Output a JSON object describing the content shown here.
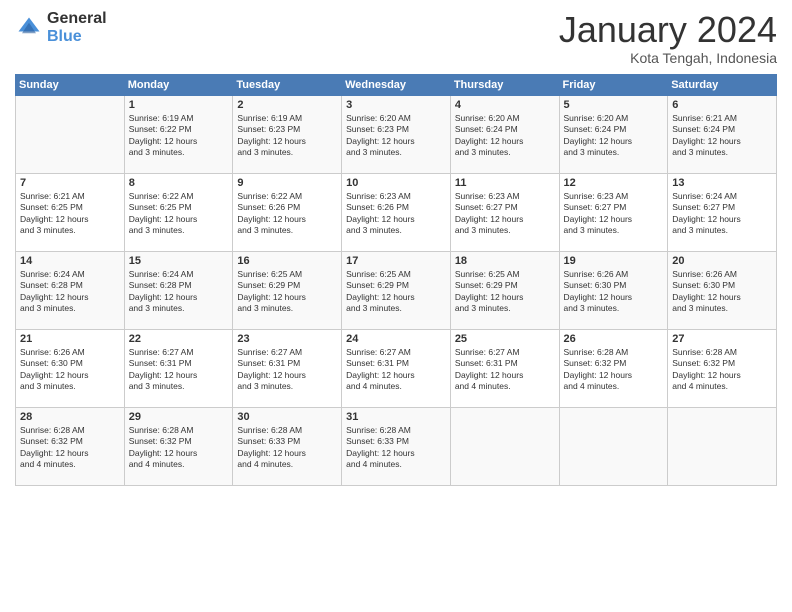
{
  "header": {
    "logo_general": "General",
    "logo_blue": "Blue",
    "month_title": "January 2024",
    "subtitle": "Kota Tengah, Indonesia"
  },
  "days_of_week": [
    "Sunday",
    "Monday",
    "Tuesday",
    "Wednesday",
    "Thursday",
    "Friday",
    "Saturday"
  ],
  "weeks": [
    [
      {
        "day": "",
        "lines": []
      },
      {
        "day": "1",
        "lines": [
          "Sunrise: 6:19 AM",
          "Sunset: 6:22 PM",
          "Daylight: 12 hours",
          "and 3 minutes."
        ]
      },
      {
        "day": "2",
        "lines": [
          "Sunrise: 6:19 AM",
          "Sunset: 6:23 PM",
          "Daylight: 12 hours",
          "and 3 minutes."
        ]
      },
      {
        "day": "3",
        "lines": [
          "Sunrise: 6:20 AM",
          "Sunset: 6:23 PM",
          "Daylight: 12 hours",
          "and 3 minutes."
        ]
      },
      {
        "day": "4",
        "lines": [
          "Sunrise: 6:20 AM",
          "Sunset: 6:24 PM",
          "Daylight: 12 hours",
          "and 3 minutes."
        ]
      },
      {
        "day": "5",
        "lines": [
          "Sunrise: 6:20 AM",
          "Sunset: 6:24 PM",
          "Daylight: 12 hours",
          "and 3 minutes."
        ]
      },
      {
        "day": "6",
        "lines": [
          "Sunrise: 6:21 AM",
          "Sunset: 6:24 PM",
          "Daylight: 12 hours",
          "and 3 minutes."
        ]
      }
    ],
    [
      {
        "day": "7",
        "lines": [
          "Sunrise: 6:21 AM",
          "Sunset: 6:25 PM",
          "Daylight: 12 hours",
          "and 3 minutes."
        ]
      },
      {
        "day": "8",
        "lines": [
          "Sunrise: 6:22 AM",
          "Sunset: 6:25 PM",
          "Daylight: 12 hours",
          "and 3 minutes."
        ]
      },
      {
        "day": "9",
        "lines": [
          "Sunrise: 6:22 AM",
          "Sunset: 6:26 PM",
          "Daylight: 12 hours",
          "and 3 minutes."
        ]
      },
      {
        "day": "10",
        "lines": [
          "Sunrise: 6:23 AM",
          "Sunset: 6:26 PM",
          "Daylight: 12 hours",
          "and 3 minutes."
        ]
      },
      {
        "day": "11",
        "lines": [
          "Sunrise: 6:23 AM",
          "Sunset: 6:27 PM",
          "Daylight: 12 hours",
          "and 3 minutes."
        ]
      },
      {
        "day": "12",
        "lines": [
          "Sunrise: 6:23 AM",
          "Sunset: 6:27 PM",
          "Daylight: 12 hours",
          "and 3 minutes."
        ]
      },
      {
        "day": "13",
        "lines": [
          "Sunrise: 6:24 AM",
          "Sunset: 6:27 PM",
          "Daylight: 12 hours",
          "and 3 minutes."
        ]
      }
    ],
    [
      {
        "day": "14",
        "lines": [
          "Sunrise: 6:24 AM",
          "Sunset: 6:28 PM",
          "Daylight: 12 hours",
          "and 3 minutes."
        ]
      },
      {
        "day": "15",
        "lines": [
          "Sunrise: 6:24 AM",
          "Sunset: 6:28 PM",
          "Daylight: 12 hours",
          "and 3 minutes."
        ]
      },
      {
        "day": "16",
        "lines": [
          "Sunrise: 6:25 AM",
          "Sunset: 6:29 PM",
          "Daylight: 12 hours",
          "and 3 minutes."
        ]
      },
      {
        "day": "17",
        "lines": [
          "Sunrise: 6:25 AM",
          "Sunset: 6:29 PM",
          "Daylight: 12 hours",
          "and 3 minutes."
        ]
      },
      {
        "day": "18",
        "lines": [
          "Sunrise: 6:25 AM",
          "Sunset: 6:29 PM",
          "Daylight: 12 hours",
          "and 3 minutes."
        ]
      },
      {
        "day": "19",
        "lines": [
          "Sunrise: 6:26 AM",
          "Sunset: 6:30 PM",
          "Daylight: 12 hours",
          "and 3 minutes."
        ]
      },
      {
        "day": "20",
        "lines": [
          "Sunrise: 6:26 AM",
          "Sunset: 6:30 PM",
          "Daylight: 12 hours",
          "and 3 minutes."
        ]
      }
    ],
    [
      {
        "day": "21",
        "lines": [
          "Sunrise: 6:26 AM",
          "Sunset: 6:30 PM",
          "Daylight: 12 hours",
          "and 3 minutes."
        ]
      },
      {
        "day": "22",
        "lines": [
          "Sunrise: 6:27 AM",
          "Sunset: 6:31 PM",
          "Daylight: 12 hours",
          "and 3 minutes."
        ]
      },
      {
        "day": "23",
        "lines": [
          "Sunrise: 6:27 AM",
          "Sunset: 6:31 PM",
          "Daylight: 12 hours",
          "and 3 minutes."
        ]
      },
      {
        "day": "24",
        "lines": [
          "Sunrise: 6:27 AM",
          "Sunset: 6:31 PM",
          "Daylight: 12 hours",
          "and 4 minutes."
        ]
      },
      {
        "day": "25",
        "lines": [
          "Sunrise: 6:27 AM",
          "Sunset: 6:31 PM",
          "Daylight: 12 hours",
          "and 4 minutes."
        ]
      },
      {
        "day": "26",
        "lines": [
          "Sunrise: 6:28 AM",
          "Sunset: 6:32 PM",
          "Daylight: 12 hours",
          "and 4 minutes."
        ]
      },
      {
        "day": "27",
        "lines": [
          "Sunrise: 6:28 AM",
          "Sunset: 6:32 PM",
          "Daylight: 12 hours",
          "and 4 minutes."
        ]
      }
    ],
    [
      {
        "day": "28",
        "lines": [
          "Sunrise: 6:28 AM",
          "Sunset: 6:32 PM",
          "Daylight: 12 hours",
          "and 4 minutes."
        ]
      },
      {
        "day": "29",
        "lines": [
          "Sunrise: 6:28 AM",
          "Sunset: 6:32 PM",
          "Daylight: 12 hours",
          "and 4 minutes."
        ]
      },
      {
        "day": "30",
        "lines": [
          "Sunrise: 6:28 AM",
          "Sunset: 6:33 PM",
          "Daylight: 12 hours",
          "and 4 minutes."
        ]
      },
      {
        "day": "31",
        "lines": [
          "Sunrise: 6:28 AM",
          "Sunset: 6:33 PM",
          "Daylight: 12 hours",
          "and 4 minutes."
        ]
      },
      {
        "day": "",
        "lines": []
      },
      {
        "day": "",
        "lines": []
      },
      {
        "day": "",
        "lines": []
      }
    ]
  ]
}
